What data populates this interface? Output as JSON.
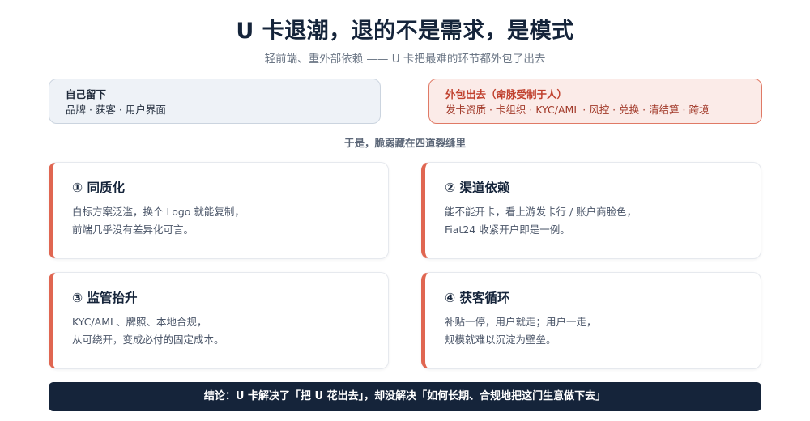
{
  "header": {
    "title": "U 卡退潮，退的不是需求，是模式",
    "subtitle": "轻前端、重外部依赖 —— U 卡把最难的环节都外包了出去"
  },
  "split": {
    "kept": {
      "title": "自己留下",
      "items": "品牌 · 获客 · 用户界面"
    },
    "outsourced": {
      "title": "外包出去（命脉受制于人）",
      "items": "发卡资质 · 卡组织 · KYC/AML · 风控 · 兑换 · 清结算 · 跨境"
    }
  },
  "transition": "于是，脆弱藏在四道裂缝里",
  "cards": [
    {
      "title": "① 同质化",
      "line1": "白标方案泛滥，换个 Logo 就能复制，",
      "line2": "前端几乎没有差异化可言。"
    },
    {
      "title": "② 渠道依赖",
      "line1": "能不能开卡，看上游发卡行 / 账户商脸色，",
      "line2": "Fiat24 收紧开户即是一例。"
    },
    {
      "title": "③ 监管抬升",
      "line1": "KYC/AML、牌照、本地合规，",
      "line2": "从可绕开，变成必付的固定成本。"
    },
    {
      "title": "④ 获客循环",
      "line1": "补贴一停，用户就走；用户一走，",
      "line2": "规模就难以沉淀为壁垒。"
    }
  ],
  "conclusion": "结论：U 卡解决了「把 U 花出去」，却没解决「如何长期、合规地把这门生意做下去」",
  "colors": {
    "navy": "#15243a",
    "accent": "#e06651",
    "kept_bg": "#eef2f7",
    "outsourced_bg": "#fbebe8"
  }
}
